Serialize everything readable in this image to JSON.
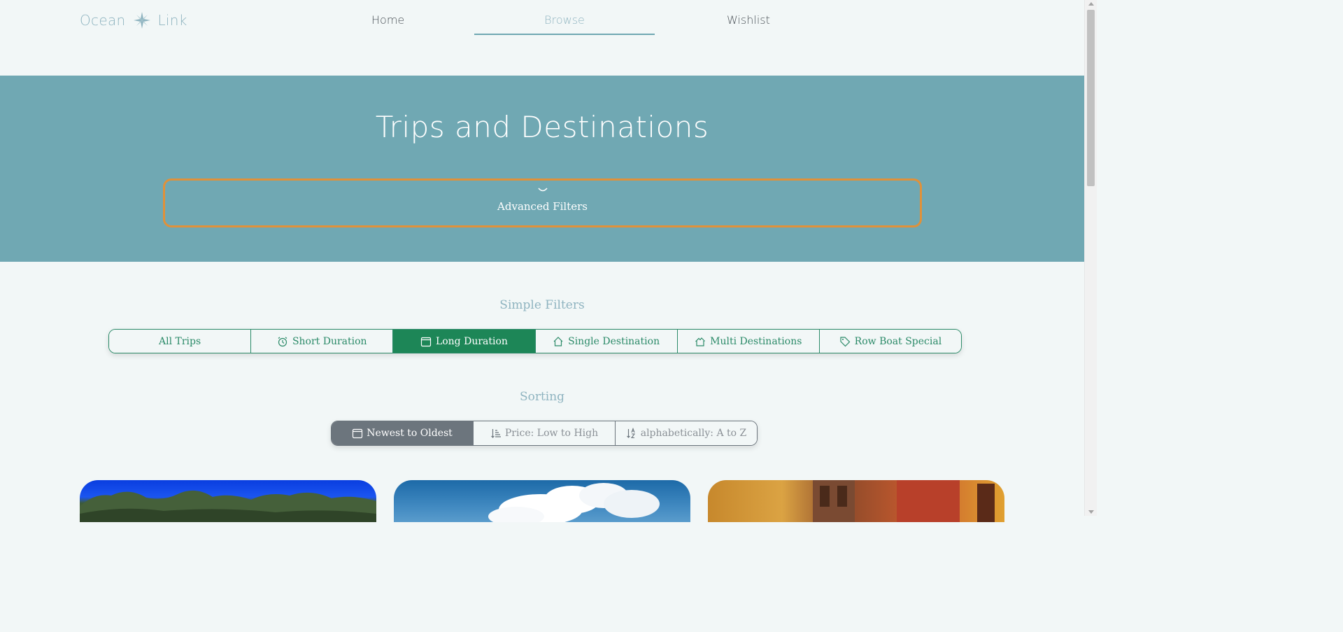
{
  "brand": {
    "name_left": "Ocean",
    "name_right": "Link",
    "logo_icon": "compass-rose-icon"
  },
  "nav": {
    "items": [
      {
        "label": "Home",
        "active": false
      },
      {
        "label": "Browse",
        "active": true
      },
      {
        "label": "Wishlist",
        "active": false
      }
    ]
  },
  "hero": {
    "title": "Trips and Destinations",
    "advanced_filters_label": "Advanced Filters",
    "advanced_filters_icon": "chevron-down-icon"
  },
  "simple_filters": {
    "title": "Simple Filters",
    "items": [
      {
        "label": "All Trips",
        "icon": "",
        "active": false
      },
      {
        "label": "Short Duration",
        "icon": "alarm-clock-icon",
        "active": false
      },
      {
        "label": "Long Duration",
        "icon": "calendar-icon",
        "active": true
      },
      {
        "label": "Single Destination",
        "icon": "house-icon",
        "active": false
      },
      {
        "label": "Multi Destinations",
        "icon": "houses-icon",
        "active": false
      },
      {
        "label": "Row Boat Special",
        "icon": "tag-icon",
        "active": false
      }
    ]
  },
  "sorting": {
    "title": "Sorting",
    "items": [
      {
        "label": "Newest to Oldest",
        "icon": "calendar-icon",
        "active": true
      },
      {
        "label": "Price: Low to High",
        "icon": "sort-numeric-down-icon",
        "active": false
      },
      {
        "label": "alphabetically: A to Z",
        "icon": "sort-alpha-down-icon",
        "active": false
      }
    ]
  },
  "colors": {
    "background": "#f2f7f7",
    "hero": "#70a8b3",
    "accent_orange": "#e0913a",
    "filter_green": "#1d8657",
    "sort_gray": "#6c757d",
    "nav_active": "#8fb4c0"
  }
}
